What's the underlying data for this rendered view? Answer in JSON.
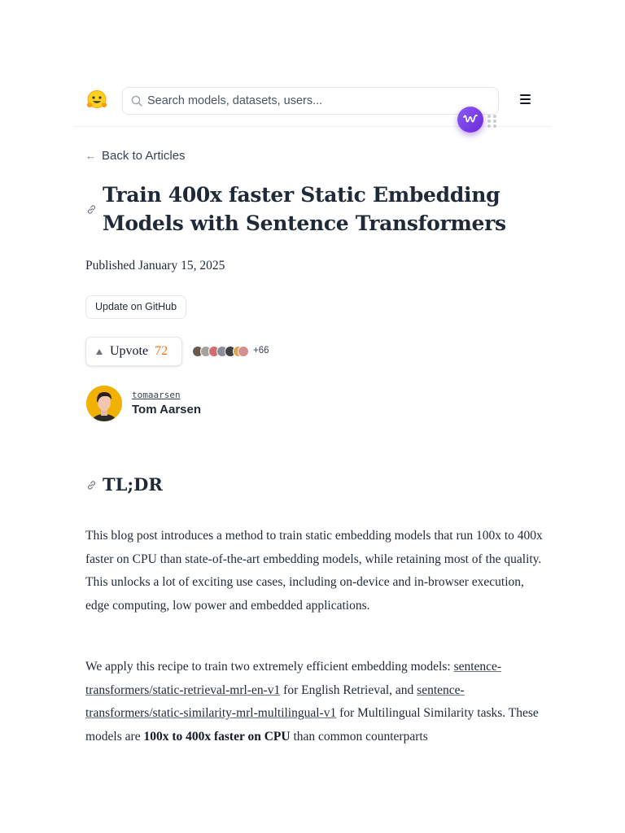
{
  "nav": {
    "search_placeholder": "Search models, datasets, users..."
  },
  "article": {
    "back_label": "Back to Articles",
    "title": "Train 400x faster Static Embedding Models with Sentence Transformers",
    "published": "Published January 15, 2025",
    "github_label": "Update on GitHub",
    "upvote_label": "Upvote",
    "upvote_count": "72",
    "voters_more": "+66",
    "author": {
      "handle": "tomaarsen",
      "name": "Tom Aarsen"
    },
    "section_title": "TL;DR",
    "p1": "This blog post introduces a method to train static embedding models that run 100x to 400x faster on CPU than state-of-the-art embedding models, while retaining most of the quality. This unlocks a lot of exciting use cases, including on-device and in-browser execution, edge computing, low power and embedded applications.",
    "p2": {
      "t1": "We apply this recipe to train two extremely efficient embedding models: ",
      "link1": "sentence-transformers/static-retrieval-mrl-en-v1",
      "t2": " for English Retrieval, and ",
      "link2": "sentence-transformers/static-similarity-mrl-multilingual-v1",
      "t3": " for Multilingual Similarity tasks. These models are ",
      "bold": "100x to 400x faster on CPU",
      "t4": " than common counterparts"
    }
  },
  "colors": {
    "accent_upvote": "#f97316",
    "widget": "#7c3aed"
  }
}
